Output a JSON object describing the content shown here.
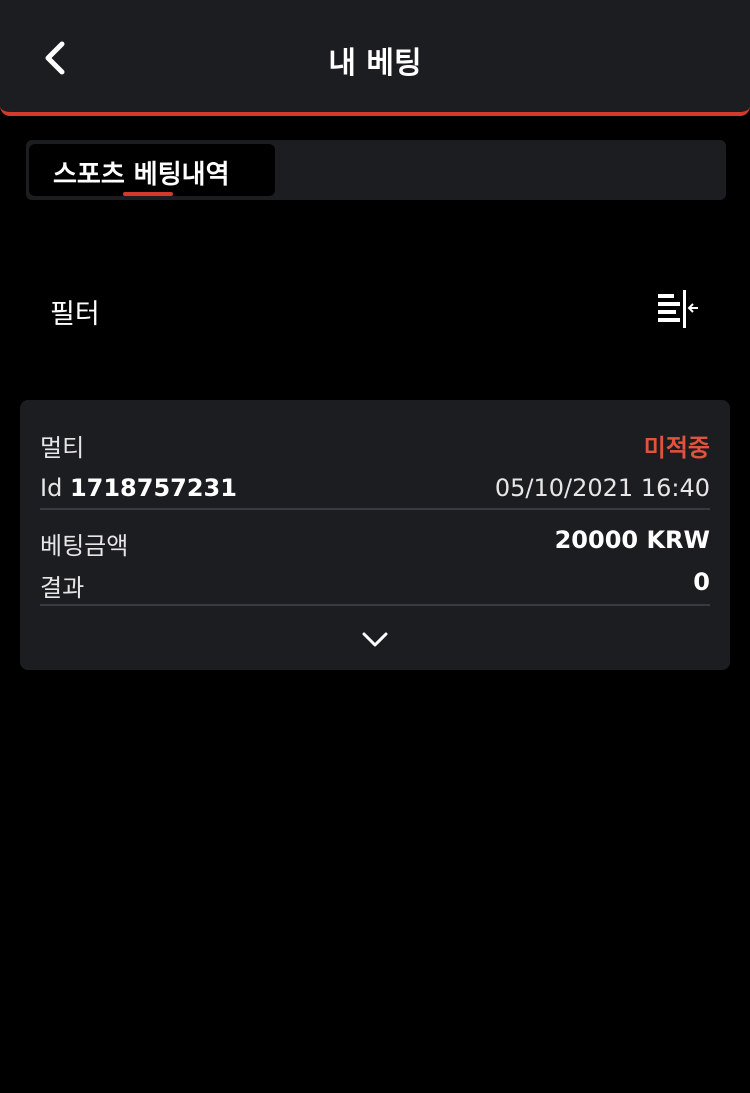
{
  "header": {
    "title": "내 베팅",
    "back_icon": "chevron-left-icon"
  },
  "tabs": [
    {
      "label": "스포츠 베팅내역",
      "active": true
    }
  ],
  "filter": {
    "label": "필터",
    "icon": "filter-collapse-icon"
  },
  "bet": {
    "type": "멀티",
    "status": "미적중",
    "id_label": "Id",
    "id_value": "1718757231",
    "datetime": "05/10/2021 16:40",
    "amount_label": "베팅금액",
    "amount_value": "20000 KRW",
    "result_label": "결과",
    "result_value": "0",
    "expand_icon": "chevron-down-icon"
  },
  "colors": {
    "accent": "#d23a2c",
    "status_lost": "#e0533d",
    "panel": "#1c1d21",
    "background": "#000000"
  }
}
